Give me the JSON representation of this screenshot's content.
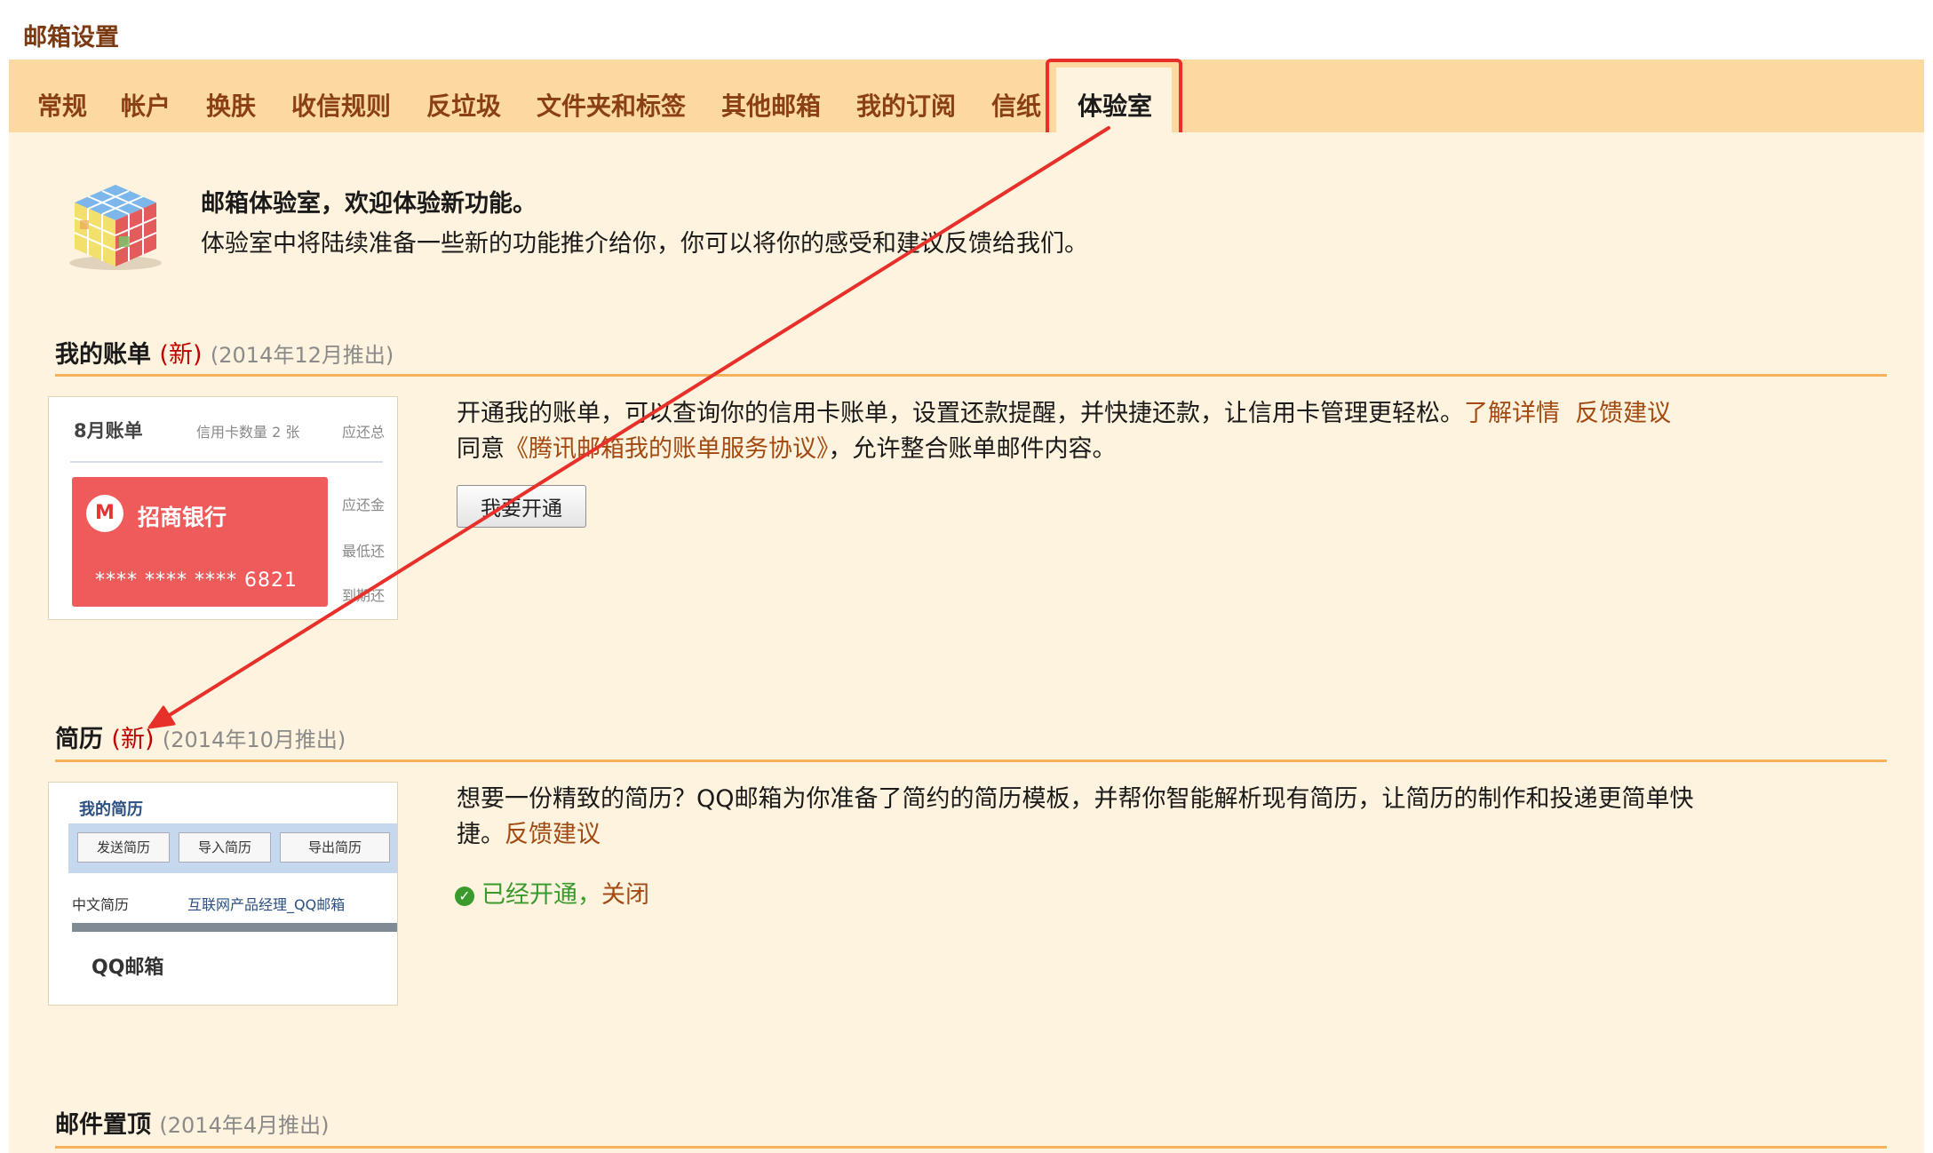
{
  "page_title": "邮箱设置",
  "tabs": [
    {
      "label": "常规"
    },
    {
      "label": "帐户"
    },
    {
      "label": "换肤"
    },
    {
      "label": "收信规则"
    },
    {
      "label": "反垃圾"
    },
    {
      "label": "文件夹和标签"
    },
    {
      "label": "其他邮箱"
    },
    {
      "label": "我的订阅"
    },
    {
      "label": "信纸"
    },
    {
      "label": "体验室",
      "active": true
    }
  ],
  "intro": {
    "title": "邮箱体验室，欢迎体验新功能。",
    "desc": "体验室中将陆续准备一些新的功能推介给你，你可以将你的感受和建议反馈给我们。"
  },
  "sections": {
    "bill": {
      "title": "我的账单",
      "new_tag": "(新)",
      "date": "(2014年12月推出)",
      "desc": "开通我的账单，可以查询你的信用卡账单，设置还款提醒，并快捷还款，让信用卡管理更轻松。",
      "link_details": "了解详情",
      "link_feedback": "反馈建议",
      "agree_prefix": "同意",
      "agreement_link": "《腾讯邮箱我的账单服务协议》",
      "agree_suffix": "，允许整合账单邮件内容。",
      "open_button": "我要开通",
      "thumb": {
        "month": "8月账单",
        "card_count": "信用卡数量 2 张",
        "due_total": "应还总",
        "bank": "招商银行",
        "card_number": "**** **** ****  6821",
        "due": "应还金",
        "min_due": "最低还",
        "fee": "到期还"
      }
    },
    "resume": {
      "title": "简历",
      "new_tag": "(新)",
      "date": "(2014年10月推出)",
      "desc_line1": "想要一份精致的简历？QQ邮箱为你准备了简约的简历模板，并帮你智能解析现有简历，让简历的制作和投递更简单快",
      "desc_line2": "捷。",
      "link_feedback": "反馈建议",
      "status_text": "已经开通，",
      "close_link": "关闭",
      "thumb": {
        "title": "我的简历",
        "send": "发送简历",
        "import": "导入简历",
        "export": "导出简历",
        "lang": "中文简历",
        "job": "互联网产品经理_QQ邮箱",
        "logo": "QQ邮箱"
      }
    },
    "pin": {
      "title": "邮件置顶",
      "date": "(2014年4月推出)"
    }
  },
  "colors": {
    "tab_bar": "#fdd9a2",
    "content_bg": "#fef3de",
    "link": "#a24a12",
    "new_tag": "#c00000",
    "annotation": "#e8302a",
    "success": "#3a9a2c"
  }
}
